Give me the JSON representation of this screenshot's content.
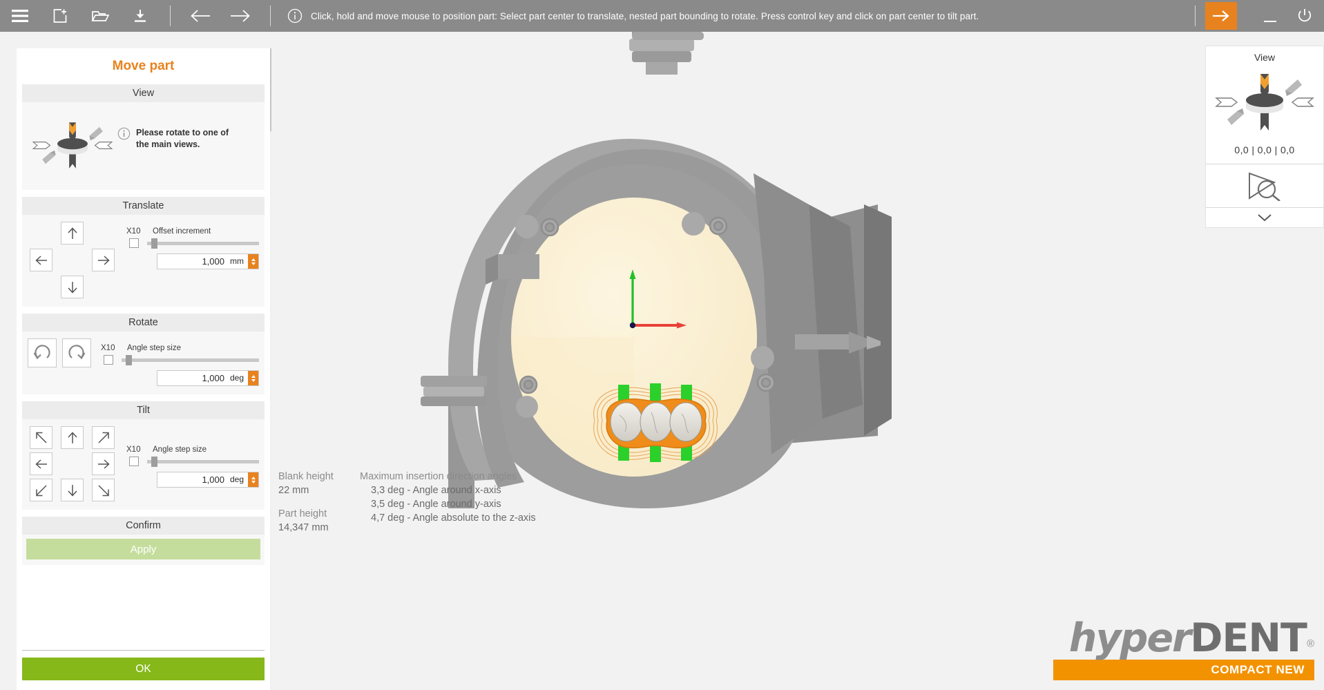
{
  "topbar": {
    "hint": "Click, hold and move mouse to position part: Select part center to translate, nested part bounding to rotate. Press control key and click on part center to tilt part.",
    "menu_label": "Menu",
    "new_label": "New",
    "open_label": "Open",
    "save_label": "Save",
    "back_label": "Back",
    "forward_label": "Forward",
    "apply_label": "Continue",
    "minimize_label": "Minimize",
    "close_label": "Exit",
    "accent": "#e8821e",
    "background": "#8a8a8a"
  },
  "panel": {
    "title": "Move part",
    "view": {
      "header": "View",
      "info": "Please rotate to one of the main views."
    },
    "translate": {
      "header": "Translate",
      "x10_label": "X10",
      "step_label": "Offset increment",
      "value": "1,000",
      "unit": "mm",
      "x10_checked": false,
      "slider_pct": 6
    },
    "rotate": {
      "header": "Rotate",
      "x10_label": "X10",
      "step_label": "Angle step size",
      "value": "1,000",
      "unit": "deg",
      "x10_checked": false,
      "slider_pct": 6
    },
    "tilt": {
      "header": "Tilt",
      "x10_label": "X10",
      "step_label": "Angle step size",
      "value": "1,000",
      "unit": "deg",
      "x10_checked": false,
      "slider_pct": 6
    },
    "confirm": {
      "header": "Confirm",
      "apply_label": "Apply",
      "apply_enabled": false
    },
    "ok_label": "OK"
  },
  "readout": {
    "blank_height_label": "Blank height",
    "blank_height_value": "22 mm",
    "part_height_label": "Part height",
    "part_height_value": "14,347 mm",
    "angles_title": "Maximum insertion direction angles",
    "angles": [
      "3,3 deg - Angle around x-axis",
      "3,5 deg - Angle around y-axis",
      "4,7 deg - Angle absolute to the z-axis"
    ]
  },
  "rightpanel": {
    "title": "View",
    "coords": "0,0  |   0,0 |   0,0",
    "zoom_label": "Zoom to fit",
    "expand_label": "More"
  },
  "logo": {
    "hyper": "hyper",
    "dent": "DENT",
    "reg": "®",
    "tagline": "COMPACT NEW",
    "bar_color": "#f39200"
  },
  "viewport": {
    "axis_x_color": "#e8413a",
    "axis_y_color": "#22c02a",
    "blank_color": "#faeecd",
    "fixture_color": "#9a9a9a",
    "part_outline_color": "#e8821e",
    "pin_color": "#22c02a"
  }
}
